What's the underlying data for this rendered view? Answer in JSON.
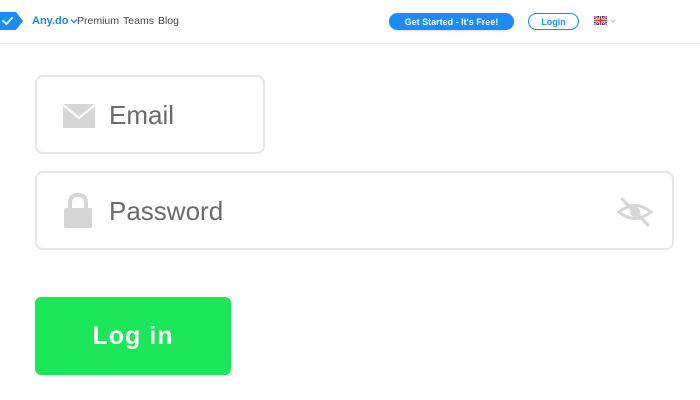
{
  "navbar": {
    "brand": "Any.do",
    "links": [
      "Premium",
      "Teams",
      "Blog"
    ],
    "cta_label": "Get Started - It's Free!",
    "login_label": "Login",
    "language_icon": "uk-flag-icon"
  },
  "form": {
    "email_placeholder": "Email",
    "password_placeholder": "Password",
    "email_icon": "envelope-icon",
    "password_icon": "lock-icon",
    "visibility_icon": "eye-off-icon",
    "submit_label": "Log in"
  },
  "colors": {
    "brand_blue": "#1a8cff",
    "submit_green": "#1ee65a",
    "field_border": "#e6e6e6",
    "icon_gray": "#d6d6d6"
  }
}
